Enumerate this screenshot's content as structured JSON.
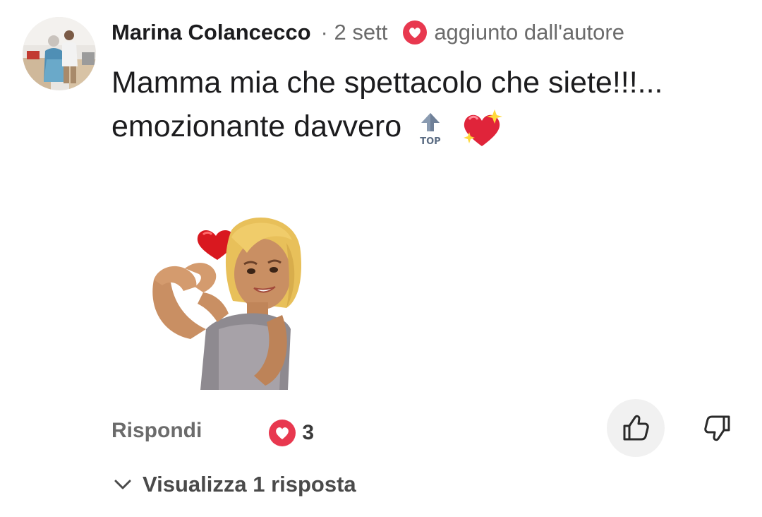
{
  "comment": {
    "author": "Marina Colancecco",
    "time": "· 2 sett",
    "badge": {
      "icon": "heart-circle-icon",
      "label": "aggiunto dall'autore",
      "color": "#e8384f"
    },
    "text_line1": "Mamma mia che spettacolo che siete!!!...",
    "text_line2": "emozionante davvero",
    "text_emojis": [
      "top-arrow-icon",
      "sparkling-heart-icon"
    ],
    "sticker": "avatar-heart-hands-sticker"
  },
  "actions": {
    "reply_label": "Rispondi",
    "reaction_icon": "heart-reaction-icon",
    "reaction_count": "3",
    "like_icon": "thumbs-up-icon",
    "dislike_icon": "thumbs-down-icon"
  },
  "replies": {
    "toggle_icon": "chevron-down-icon",
    "label": "Visualizza 1 risposta"
  },
  "colors": {
    "accent": "#e8384f",
    "text_primary": "#1c1c1e",
    "text_secondary": "#6b6b6b"
  }
}
